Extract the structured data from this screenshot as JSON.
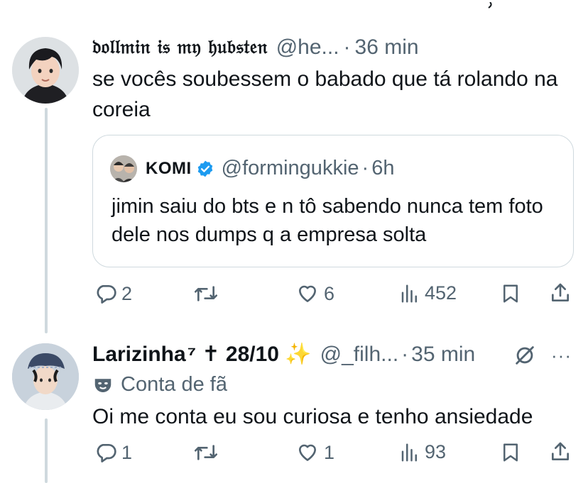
{
  "post1": {
    "display_name": "𝔡𝔬𝔩𝔩𝔪𝔦𝔫 𝔦𝔰 𝔪𝔶 𝔥𝔲𝔟𝔰𝔱𝔢𝔫",
    "handle": "@he...",
    "separator": "·",
    "time": "36 min",
    "text": "se vocês soubessem o babado que tá rolando na coreia",
    "quote": {
      "display_name": "KOMI",
      "handle": "@formingukkie",
      "separator": "·",
      "time": "6h",
      "text": "jimin saiu do bts e n tô sabendo nunca tem foto dele nos dumps q a empresa solta"
    },
    "actions": {
      "replies": "2",
      "likes": "6",
      "views": "452"
    }
  },
  "post2": {
    "display_name": "Larizinha",
    "name_suffix": "⁷ ✝ 28/10 ✨",
    "handle": "@_filh...",
    "separator": "·",
    "time": "35 min",
    "more": "···",
    "fan_label": "Conta de fã",
    "text": "Oi me conta eu sou curiosa e tenho ansiedade",
    "actions": {
      "replies": "1",
      "likes": "1",
      "views": "93"
    }
  },
  "colors": {
    "verified": "#1d9bf0",
    "muted": "#536471",
    "sparkle": "#ffd43b"
  },
  "icons": [
    "reply-icon",
    "repost-icon",
    "like-icon",
    "views-icon",
    "bookmark-icon",
    "share-icon",
    "verified-icon",
    "grok-slash-icon",
    "mask-icon"
  ]
}
